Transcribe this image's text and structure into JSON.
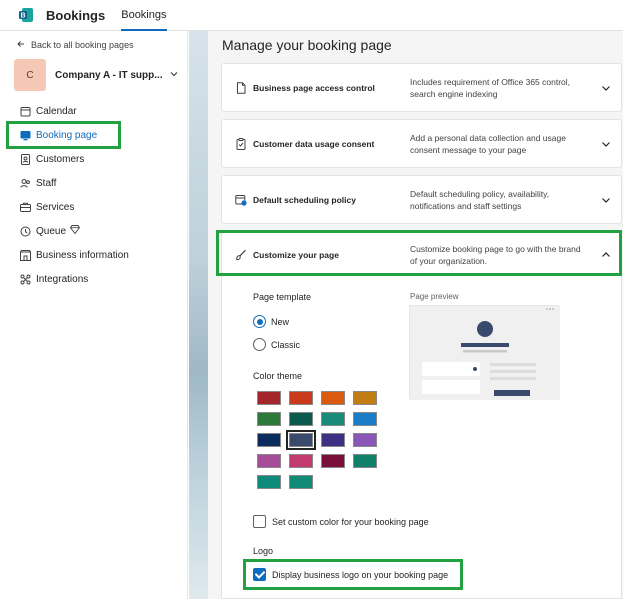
{
  "app": {
    "name": "Bookings",
    "tab": "Bookings"
  },
  "sidebar": {
    "back_label": "Back to all booking pages",
    "company_initial": "C",
    "company_name": "Company A - IT supp...",
    "items": [
      {
        "label": "Calendar",
        "icon": "calendar-icon"
      },
      {
        "label": "Booking page",
        "icon": "booking-page-icon",
        "active": true
      },
      {
        "label": "Customers",
        "icon": "customers-icon"
      },
      {
        "label": "Staff",
        "icon": "staff-icon"
      },
      {
        "label": "Services",
        "icon": "services-icon"
      },
      {
        "label": "Queue",
        "icon": "queue-icon"
      },
      {
        "label": "Business information",
        "icon": "business-info-icon"
      },
      {
        "label": "Integrations",
        "icon": "integrations-icon"
      }
    ]
  },
  "main": {
    "title": "Manage your booking page",
    "sections": [
      {
        "title": "Business page access control",
        "desc": "Includes requirement of Office 365 control, search engine indexing"
      },
      {
        "title": "Customer data usage consent",
        "desc": "Add a personal data collection and usage consent message to your page"
      },
      {
        "title": "Default scheduling policy",
        "desc": "Default scheduling policy, availability, notifications and staff settings"
      },
      {
        "title": "Customize your page",
        "desc": "Customize booking page to go with the brand of your organization."
      }
    ],
    "customize": {
      "template_label": "Page template",
      "preview_label": "Page preview",
      "template_options": [
        "New",
        "Classic"
      ],
      "selected_template": "New",
      "color_theme_label": "Color theme",
      "colors": [
        "#a4262c",
        "#ca3a1c",
        "#da5a10",
        "#c17d14",
        "#2b7a3a",
        "#0b5a4e",
        "#1a8a7a",
        "#1b7cc8",
        "#0a2d5e",
        "#3a4a6c",
        "#3d2f82",
        "#8a57b8",
        "#a64c98",
        "#c23a6e",
        "#7a0f3a",
        "#11806a",
        "#0f8b7c",
        "#128a78"
      ],
      "selected_color_index": 9,
      "custom_color_label": "Set custom color for your booking page",
      "logo_label": "Logo",
      "display_logo_label": "Display business logo on your booking page",
      "display_logo_checked": true
    }
  },
  "colors": {
    "accent": "#0f6cbd",
    "highlight": "#21a142"
  }
}
